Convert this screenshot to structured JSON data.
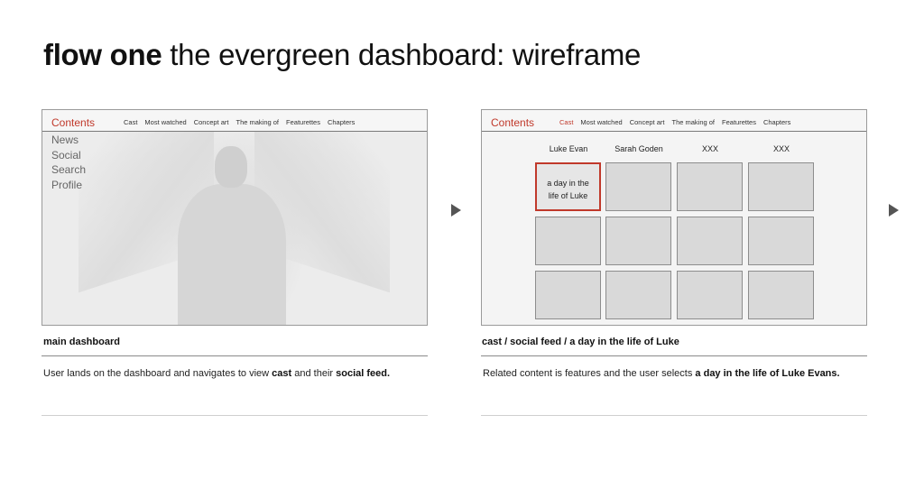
{
  "title": {
    "bold": "flow one",
    "rest": "the evergreen dashboard: wireframe"
  },
  "screens": [
    {
      "brand": "Contents",
      "menu": [
        "Cast",
        "Most watched",
        "Concept art",
        "The making of",
        "Featurettes",
        "Chapters"
      ],
      "sidebar": [
        "News",
        "Social",
        "Search",
        "Profile"
      ],
      "caption": "main dashboard",
      "description": {
        "p1": "User lands on the dashboard and navigates to view ",
        "b1": "cast",
        "p2": " and their ",
        "b2": "social feed."
      }
    },
    {
      "brand": "Contents",
      "menu": [
        "Cast",
        "Most watched",
        "Concept art",
        "The making of",
        "Featurettes",
        "Chapters"
      ],
      "active_menu": "Cast",
      "cast_names": [
        "Luke Evan",
        "Sarah Goden",
        "XXX",
        "XXX"
      ],
      "selected_tile": {
        "line1": "a day in the",
        "line2": "life of Luke"
      },
      "caption": "cast / social feed / a day in the life of Luke",
      "description": {
        "p1": "Related content is features and the user selects ",
        "b1": "a day in the life of Luke Evans."
      }
    }
  ],
  "colors": {
    "accent": "#c0392b",
    "tile": "#d9d9d9",
    "arrow": "#555555"
  },
  "icons": {
    "next": "play-triangle-icon"
  }
}
